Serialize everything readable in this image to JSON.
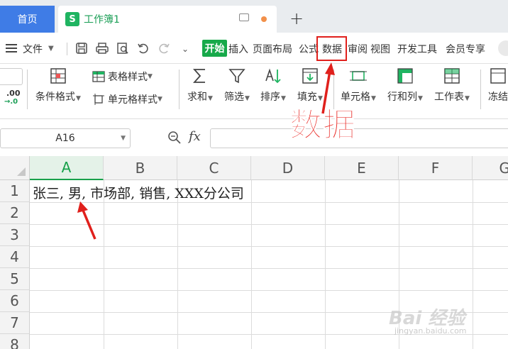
{
  "tabs": {
    "home_label": "首页",
    "doc_logo": "S",
    "doc_title": "工作簿1",
    "new_tab": "+"
  },
  "menubar": {
    "file_label": "文件",
    "items": [
      "开始",
      "插入",
      "页面布局",
      "公式",
      "数据",
      "审阅",
      "视图",
      "开发工具",
      "会员专享"
    ]
  },
  "ribbon": {
    "number_format": ".00",
    "number_format2": "→.0",
    "conditional_format": "条件格式",
    "table_style": "表格样式",
    "cell_style": "单元格样式",
    "sum": "求和",
    "filter": "筛选",
    "sort": "排序",
    "fill": "填充",
    "cell": "单元格",
    "row_col": "行和列",
    "worksheet": "工作表",
    "freeze": "冻结"
  },
  "formula_bar": {
    "name_box": "A16",
    "fx": "fx",
    "value": ""
  },
  "sheet": {
    "columns": [
      "A",
      "B",
      "C",
      "D",
      "E",
      "F",
      "G"
    ],
    "rows": [
      "1",
      "2",
      "3",
      "4",
      "5",
      "6",
      "7",
      "8"
    ],
    "active_column": "A",
    "cell_a1": "张三, 男, 市场部, 销售, XXX分公司"
  },
  "annotation": {
    "callout": "数据",
    "color": "#e8231e"
  },
  "watermark": {
    "brand": "Bai 经验",
    "url": "jingyan.baidu.com"
  }
}
